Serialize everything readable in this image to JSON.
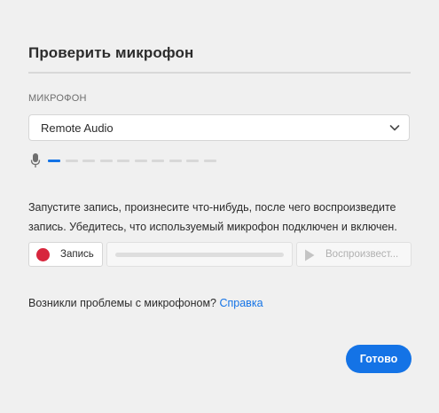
{
  "dialog": {
    "title": "Проверить микрофон"
  },
  "microphone": {
    "section_label": "МИКРОФОН",
    "selected_device": "Remote Audio",
    "icon": "chevron-down-icon",
    "level_icon": "microphone-icon",
    "level": {
      "active_segments": 1,
      "total_segments": 10
    }
  },
  "instructions": {
    "line1": "Запустите запись, произнесите что-нибудь, после чего воспроизведите",
    "line2": "запись. Убедитесь, что используемый микрофон подключен и включен."
  },
  "recorder": {
    "record_label": "Запись",
    "record_icon": "record-dot-icon",
    "progress": 0,
    "play_label": "Воспроизвест...",
    "play_icon": "play-icon",
    "play_enabled": false
  },
  "help": {
    "question": "Возникли проблемы с микрофоном?",
    "link": "Справка"
  },
  "footer": {
    "done_label": "Готово"
  },
  "colors": {
    "accent": "#1473e6",
    "record": "#d7263d",
    "background": "#f0f0f0"
  }
}
